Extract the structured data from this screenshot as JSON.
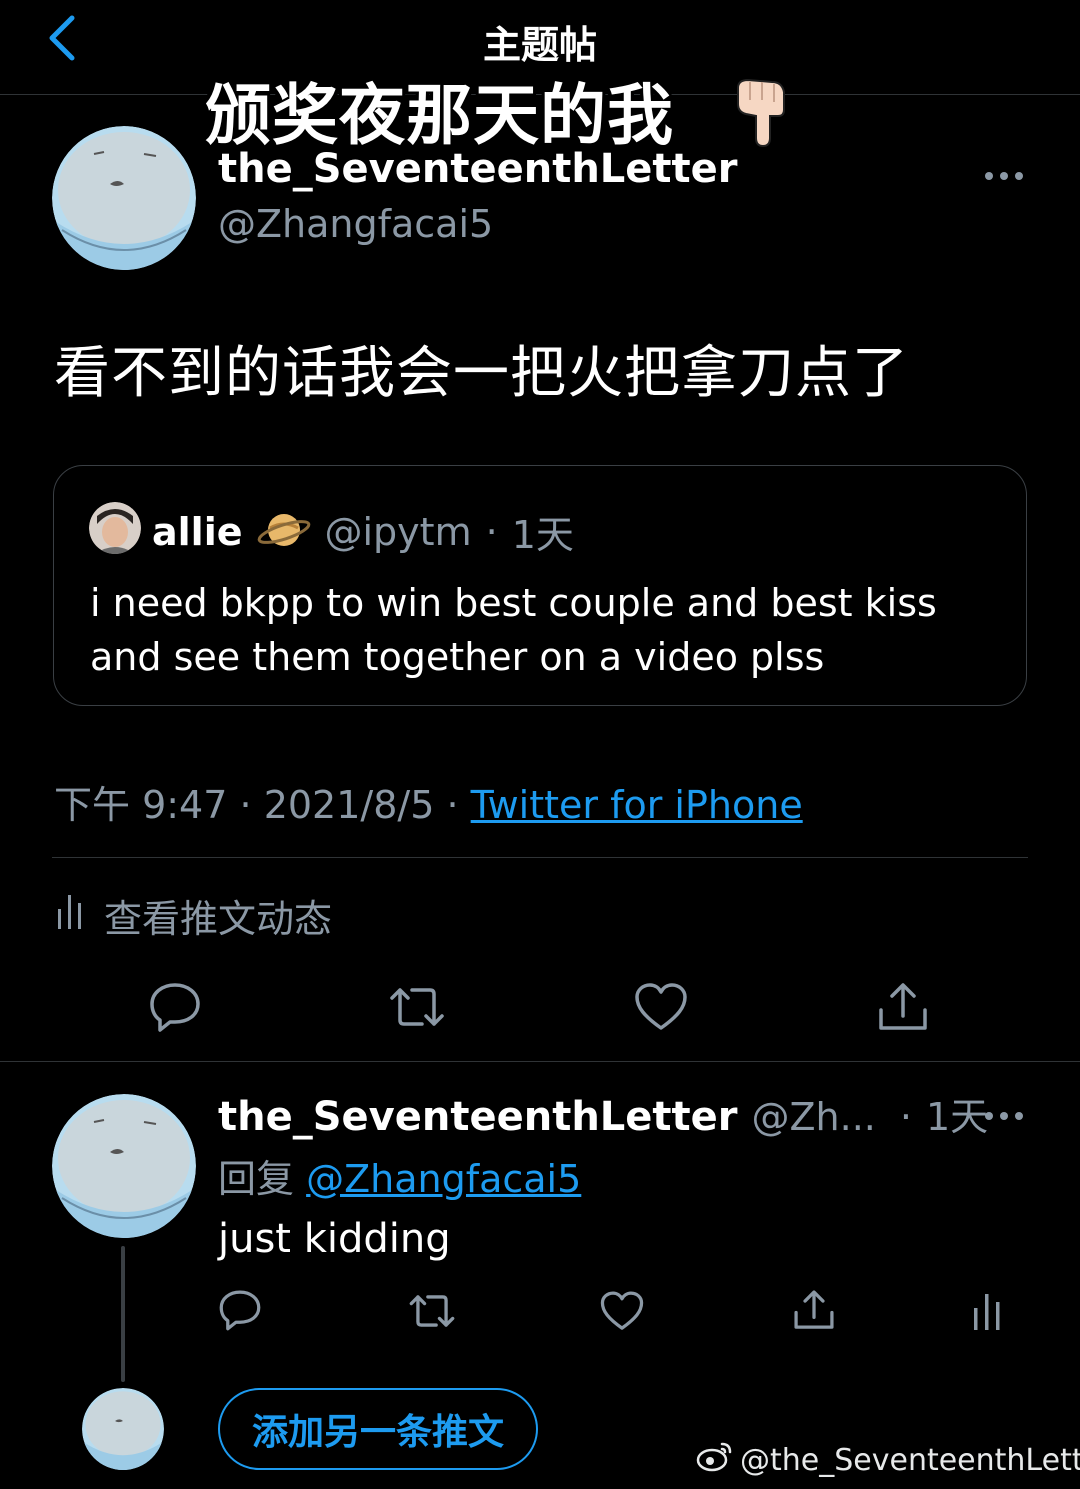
{
  "nav": {
    "title": "主题帖",
    "back_icon": "chevron-left-icon"
  },
  "overlay": {
    "caption": "颁奖夜那天的我",
    "emoji": "pointing-down-hand"
  },
  "main_tweet": {
    "display_name": "the_SeventeenthLetter",
    "handle": "@Zhangfacai5",
    "text": "看不到的话我会一把火把拿刀点了",
    "quote": {
      "name": "allie",
      "emoji": "ringed-planet",
      "handle": "@ipytm",
      "separator": "·",
      "age": "1天",
      "text": "i need bkpp to win best couple and best kiss and see them together on a video plss"
    },
    "timestamp": {
      "time": "下午 9:47",
      "sep1": "·",
      "date": "2021/8/5",
      "sep2": "·",
      "source": "Twitter for iPhone"
    },
    "analytics_label": "查看推文动态"
  },
  "reply": {
    "display_name": "the_SeventeenthLetter",
    "handle": "@Zh...",
    "separator": "·",
    "age": "1天",
    "reply_prefix": "回复",
    "reply_mention": "@Zhangfacai5",
    "text": "just kidding"
  },
  "composer": {
    "add_tweet_label": "添加另一条推文"
  },
  "watermark": {
    "text": "@the_SeventeenthLetter"
  },
  "colors": {
    "accent": "#1d9bf0",
    "secondary_text": "#8b98a5",
    "background": "#000000",
    "divider": "#2f3336"
  }
}
